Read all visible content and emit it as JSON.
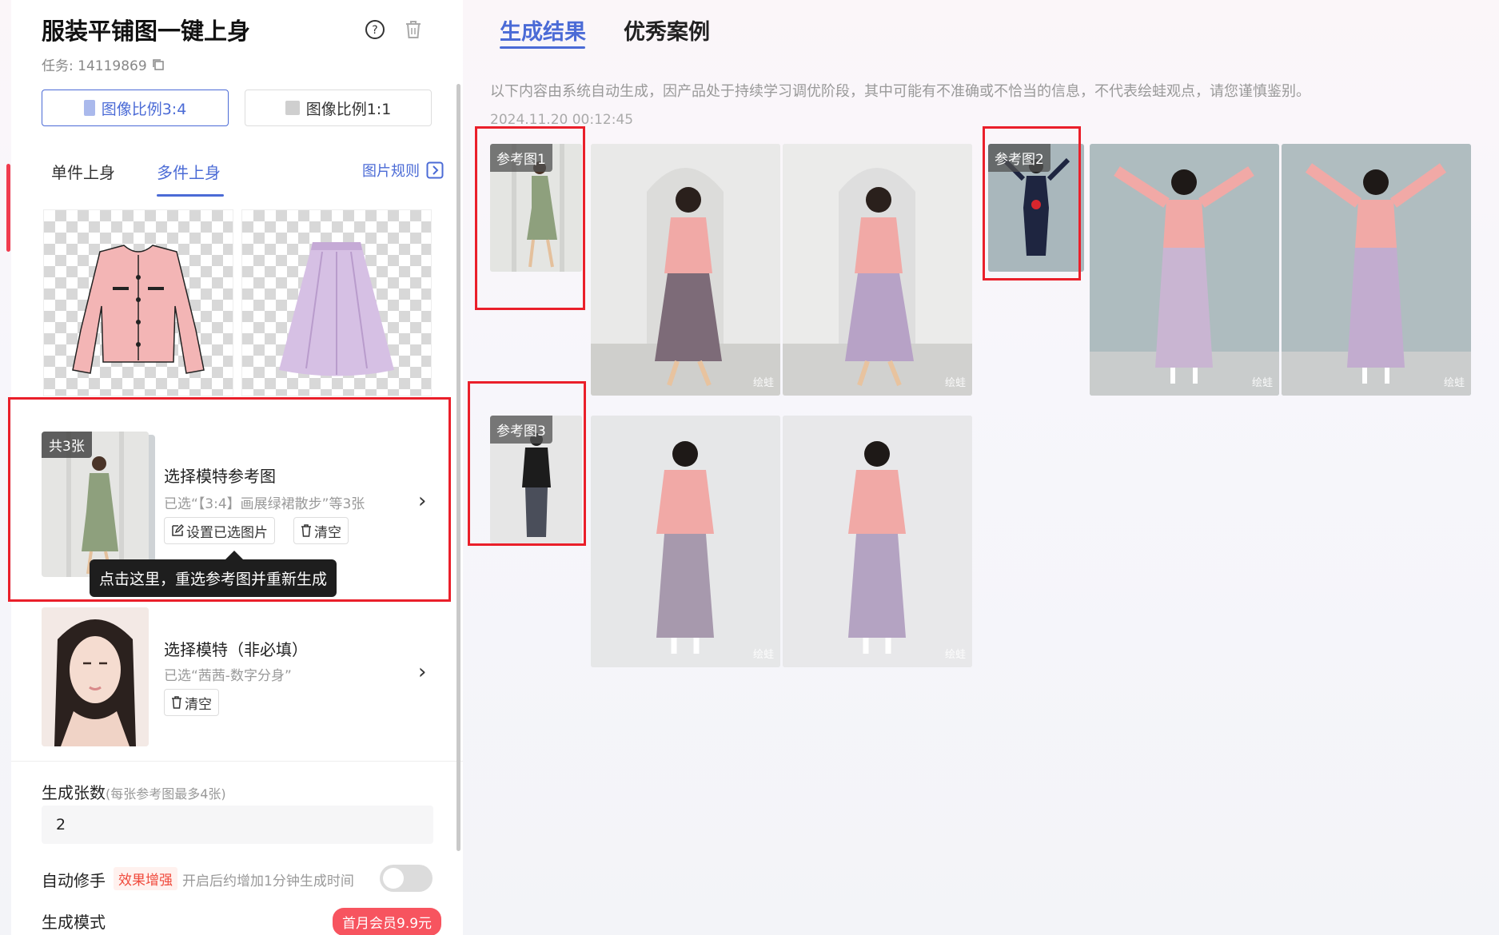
{
  "left": {
    "title": "服装平铺图一键上身",
    "task_label": "任务: 14119869",
    "ratio_buttons": [
      "图像比例3:4",
      "图像比例1:1"
    ],
    "tabs": [
      "单件上身",
      "多件上身"
    ],
    "rules_link": "图片规则",
    "ref_section": {
      "badge": "共3张",
      "title": "选择模特参考图",
      "subtitle": "已选“【3:4】画展绿裙散步”等3张",
      "set_button": "设置已选图片",
      "clear_button": "清空",
      "tooltip": "点击这里，重选参考图并重新生成"
    },
    "model_section": {
      "title": "选择模特（非必填）",
      "subtitle": "已选“茜茜-数字分身”",
      "clear_button": "清空"
    },
    "count": {
      "label": "生成张数",
      "hint": "(每张参考图最多4张)",
      "value": "2"
    },
    "auto_fix": {
      "label": "自动修手",
      "tag": "效果增强",
      "hint": "开启后约增加1分钟生成时间"
    },
    "mode": {
      "label": "生成模式",
      "promo": "首月会员9.9元"
    }
  },
  "right": {
    "tabs": [
      "生成结果",
      "优秀案例"
    ],
    "disclaimer": "以下内容由系统自动生成，因产品处于持续学习调优阶段，其中可能有不准确或不恰当的信息，不代表绘蛙观点，请您谨慎鉴别。",
    "timestamp": "2024.11.20 00:12:45",
    "ref_labels": [
      "参考图1",
      "参考图2",
      "参考图3"
    ],
    "watermark": "绘蛙"
  },
  "colors": {
    "accent": "#4b6bd6",
    "highlight_red": "#ea1f2a",
    "promo": "#f7545f"
  }
}
